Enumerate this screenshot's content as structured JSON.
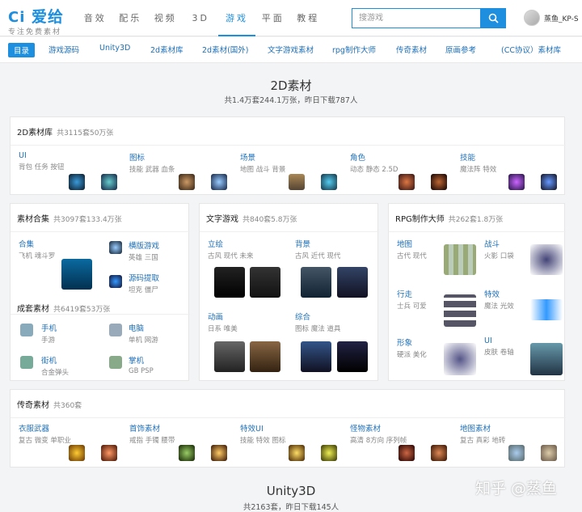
{
  "header": {
    "logo_main": "爱给",
    "logo_sub": "专注免费素材",
    "search_placeholder": "搜游戏",
    "username": "蒸鱼_KP-S",
    "nav": [
      "音效",
      "配乐",
      "视频",
      "3D",
      "游戏",
      "平面",
      "教程"
    ]
  },
  "subnav": {
    "mulu": "目录",
    "items": [
      "游戏源码",
      "Unity3D",
      "2d素材库",
      "2d素材(国外)",
      "文字游戏素材",
      "rpg制作大师",
      "传奇素材",
      "原画参考",
      "(CC协议）素材库"
    ]
  },
  "s2d": {
    "title": "2D素材",
    "sub": "共1.4万套244.1万张，昨日下载787人"
  },
  "lib2d": {
    "title": "2D素材库",
    "count": "共3115套50万张",
    "cells": [
      {
        "t": "UI",
        "d": "背包 任务 按钮"
      },
      {
        "t": "图标",
        "d": "技能 武器 血条"
      },
      {
        "t": "场景",
        "d": "地图 战斗 背景"
      },
      {
        "t": "角色",
        "d": "动态 静态 2.5D"
      },
      {
        "t": "技能",
        "d": "魔法阵 特效"
      }
    ]
  },
  "combo": {
    "title": "素材合集",
    "count": "共3097套133.4万张",
    "cells": [
      {
        "t": "合集",
        "d": "飞机 魂斗罗"
      },
      {
        "t": "横版游戏",
        "d": "英雄 三国"
      },
      {
        "t": "源码提取",
        "d": "坦克 僵尸"
      }
    ]
  },
  "sets": {
    "title": "成套素材",
    "count": "共6419套53万张",
    "cells": [
      {
        "t": "手机",
        "d": "手游"
      },
      {
        "t": "电脑",
        "d": "单机 网游"
      },
      {
        "t": "街机",
        "d": "合金弹头"
      },
      {
        "t": "掌机",
        "d": "GB PSP"
      }
    ]
  },
  "text": {
    "title": "文字游戏",
    "count": "共840套5.8万张",
    "cells": [
      {
        "t": "立绘",
        "d": "古风 现代 未来"
      },
      {
        "t": "背景",
        "d": "古风 近代 现代"
      },
      {
        "t": "动画",
        "d": "日系 唯美"
      },
      {
        "t": "综合",
        "d": "图标 魔法 道具"
      }
    ]
  },
  "rpg": {
    "title": "RPG制作大师",
    "count": "共262套1.8万张",
    "cells": [
      {
        "t": "地图",
        "d": "古代 现代"
      },
      {
        "t": "战斗",
        "d": "火影 口袋"
      },
      {
        "t": "行走",
        "d": "士兵 可爱"
      },
      {
        "t": "特效",
        "d": "魔法 光效"
      },
      {
        "t": "形象",
        "d": "硬派 美化"
      },
      {
        "t": "UI",
        "d": "皮肤 卷轴"
      }
    ]
  },
  "legend": {
    "title": "传奇素材",
    "count": "共360套",
    "cells": [
      {
        "t": "衣服武器",
        "d": "复古 微变 单职业"
      },
      {
        "t": "首饰素材",
        "d": "戒指 手镯 腰带"
      },
      {
        "t": "特效UI",
        "d": "技能 特效 图标"
      },
      {
        "t": "怪物素材",
        "d": "高清 8方向 序列帧"
      },
      {
        "t": "地图素材",
        "d": "复古 真彩 地砖"
      }
    ]
  },
  "unity": {
    "title": "Unity3D",
    "sub": "共2163套，昨日下载145人"
  },
  "watermark": "知乎 @蒸鱼",
  "colors": {
    "accent": "#1e8fdf",
    "link": "#1e6fb8"
  }
}
